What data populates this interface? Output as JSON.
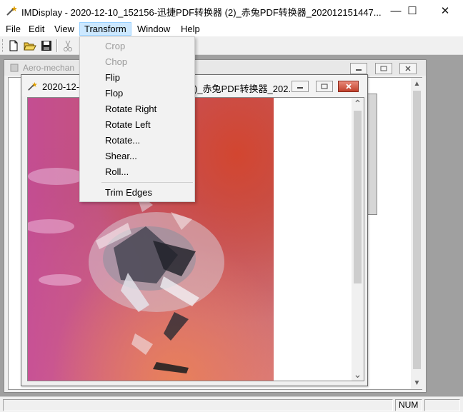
{
  "app": {
    "title": "IMDisplay - 2020-12-10_152156-迅捷PDF转换器 (2)_赤兔PDF转换器_202012151447...",
    "minimize_glyph": "—",
    "maximize_glyph": "☐",
    "close_glyph": "✕"
  },
  "menubar": {
    "items": [
      {
        "label": "File"
      },
      {
        "label": "Edit"
      },
      {
        "label": "View"
      },
      {
        "label": "Transform"
      },
      {
        "label": "Window"
      },
      {
        "label": "Help"
      }
    ],
    "active": "Transform"
  },
  "toolbar": {
    "buttons": [
      "new-file-icon",
      "open-folder-icon",
      "save-disk-icon",
      "cut-scissors-icon"
    ]
  },
  "transform_menu": {
    "items": [
      {
        "label": "Crop",
        "enabled": false
      },
      {
        "label": "Chop",
        "enabled": false
      },
      {
        "label": "Flip",
        "enabled": true
      },
      {
        "label": "Flop",
        "enabled": true
      },
      {
        "label": "Rotate Right",
        "enabled": true
      },
      {
        "label": "Rotate Left",
        "enabled": true
      },
      {
        "label": "Rotate...",
        "enabled": true
      },
      {
        "label": "Shear...",
        "enabled": true
      },
      {
        "label": "Roll...",
        "enabled": true
      }
    ],
    "after_separator": {
      "label": "Trim Edges",
      "enabled": true
    }
  },
  "background_window": {
    "title": "Aero-mechan"
  },
  "image_window": {
    "title_left": "2020-12-",
    "title_right": ")_赤兔PDF转换器_202...",
    "scroll_up_glyph": "⌃",
    "scroll_down_glyph": "⌄"
  },
  "statusbar": {
    "num_indicator": "NUM"
  },
  "colors": {
    "menu_highlight": "#cce8ff",
    "mdi_background": "#a0a0a0",
    "close_button_red": "#c2412c"
  }
}
